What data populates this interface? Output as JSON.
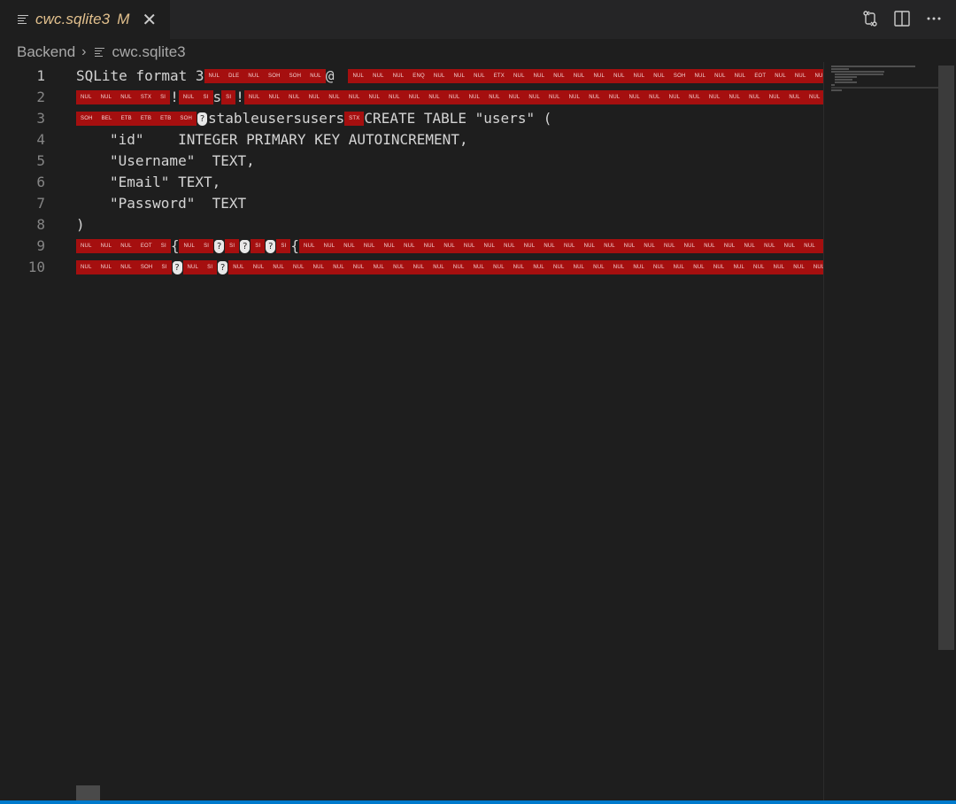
{
  "tab": {
    "title": "cwc.sqlite3",
    "status": "M",
    "close_glyph": "✕"
  },
  "actions": [
    "source-control-compare-icon",
    "split-editor-icon",
    "more-actions-icon"
  ],
  "breadcrumb": {
    "folder": "Backend",
    "separator": "›",
    "file": "cwc.sqlite3"
  },
  "lines": [
    {
      "n": "1"
    },
    {
      "n": "2"
    },
    {
      "n": "3"
    },
    {
      "n": "4"
    },
    {
      "n": "5"
    },
    {
      "n": "6"
    },
    {
      "n": "7"
    },
    {
      "n": "8"
    },
    {
      "n": "9"
    },
    {
      "n": "10"
    }
  ],
  "code": {
    "l1_text": "SQLite format 3",
    "l1_at": "@",
    "l2_s": "s",
    "l2_excl": "!",
    "l3_name": "stableusersusers",
    "l3_create": "CREATE TABLE \"users\" (",
    "l4": "\"id\"    INTEGER PRIMARY KEY AUTOINCREMENT,",
    "l5": "\"Username\"  TEXT,",
    "l6": "\"Email\" TEXT,",
    "l7": "\"Password\"  TEXT",
    "l8": ")",
    "l9_brace": "{",
    "rep_glyph": "?"
  },
  "ctl": {
    "NUL": "NUL",
    "DLE": "DLE",
    "SOH": "SOH",
    "ENQ": "ENQ",
    "ETX": "ETX",
    "EOT": "EOT",
    "STX": "STX",
    "SI": "SI",
    "BEL": "BEL",
    "ETB": "ETB",
    "SC": "SC"
  },
  "colors": {
    "control_bg": "#a50f0f",
    "modified": "#e2c08d",
    "accent": "#007acc"
  }
}
